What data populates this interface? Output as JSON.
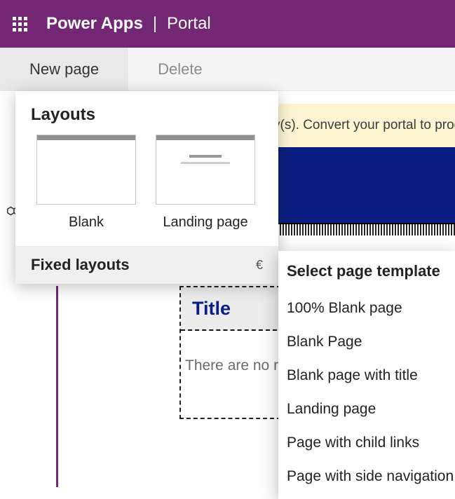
{
  "header": {
    "app": "Power Apps",
    "divider": "|",
    "context": "Portal"
  },
  "toolbar": {
    "new_page": "New page",
    "delete": "Delete"
  },
  "banner": {
    "text": "y(s). Convert your portal to product"
  },
  "flyout": {
    "layouts_heading": "Layouts",
    "cards": [
      {
        "label": "Blank"
      },
      {
        "label": "Landing page"
      }
    ],
    "fixed_heading": "Fixed layouts",
    "fixed_chevron": "€"
  },
  "canvas": {
    "title": "Title",
    "body": "There are no r"
  },
  "templates": {
    "heading": "Select page template",
    "items": [
      "100% Blank page",
      "Blank Page",
      "Blank page with title",
      "Landing page",
      "Page with child links",
      "Page with side navigation"
    ]
  }
}
